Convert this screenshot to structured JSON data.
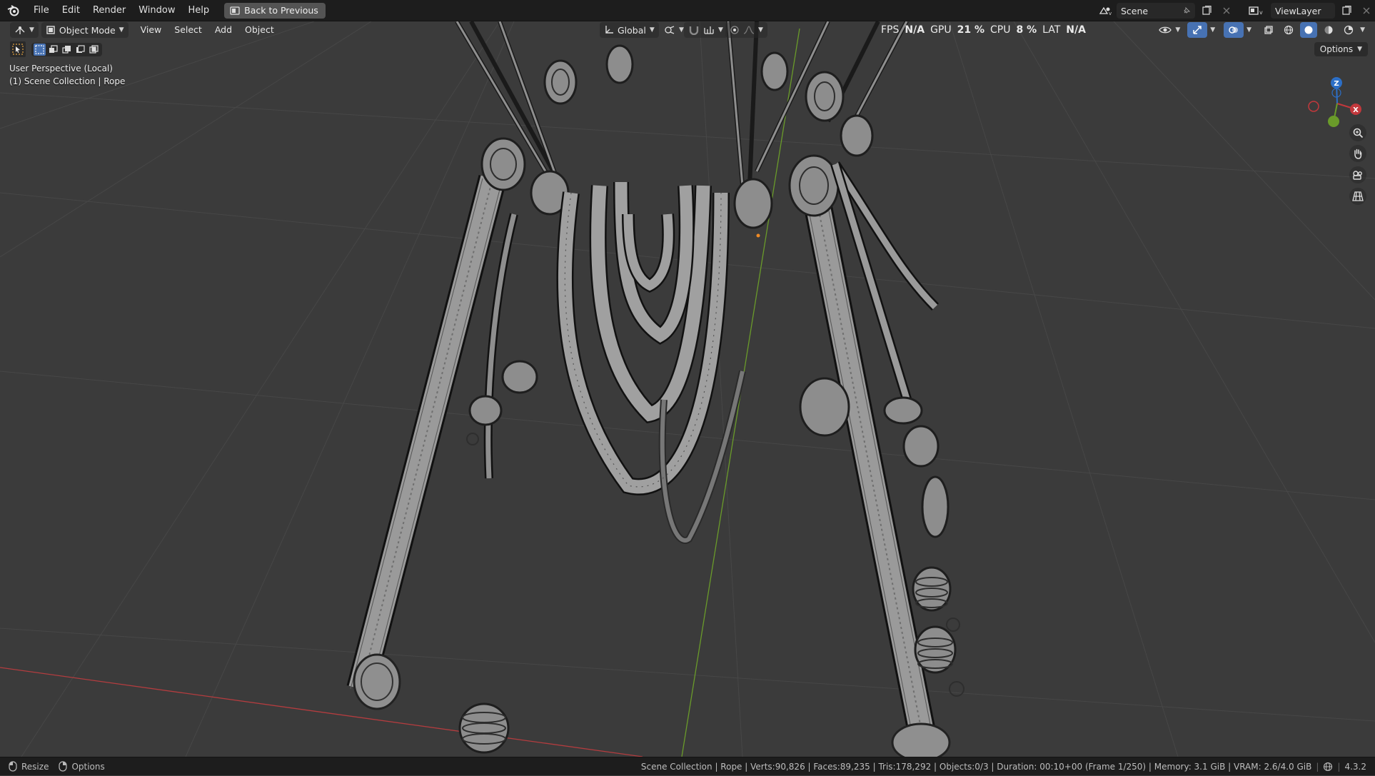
{
  "menubar": {
    "items": [
      "File",
      "Edit",
      "Render",
      "Window",
      "Help"
    ],
    "back_button": "Back to Previous",
    "scene": "Scene",
    "view_layer": "ViewLayer"
  },
  "viewport_header": {
    "mode": "Object Mode",
    "menus": [
      "View",
      "Select",
      "Add",
      "Object"
    ],
    "transform_orientation": "Global",
    "options_label": "Options"
  },
  "stats": {
    "fps_label": "FPS",
    "fps_value": "N/A",
    "gpu_label": "GPU",
    "gpu_value": "21 %",
    "cpu_label": "CPU",
    "cpu_value": "8 %",
    "lat_label": "LAT",
    "lat_value": "N/A"
  },
  "viewport_info": {
    "perspective": "User Perspective (Local)",
    "collection": "(1) Scene Collection | Rope"
  },
  "gizmo": {
    "z": "Z",
    "x": "X"
  },
  "statusbar": {
    "resize": "Resize",
    "options": "Options",
    "info": "Scene Collection | Rope | Verts:90,826 | Faces:89,235 | Tris:178,292 | Objects:0/3 | Duration: 00:10+00 (Frame 1/250) | Memory: 3.1 GiB | VRAM: 2.6/4.0 GiB",
    "version": "4.3.2"
  },
  "colors": {
    "accent_blue": "#4772b3",
    "x_axis": "#c2383c",
    "y_axis": "#6a9b2a",
    "z_axis": "#2c6fc7"
  }
}
